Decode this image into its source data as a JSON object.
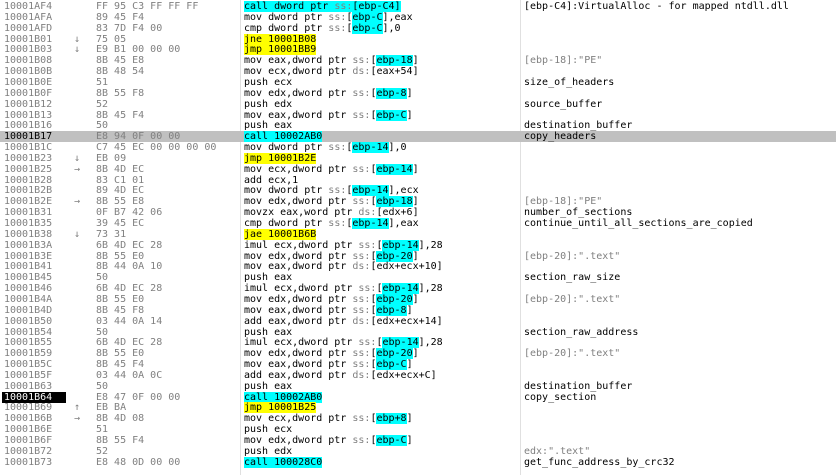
{
  "rows": [
    {
      "addr": "10001AF4",
      "arrow": "",
      "bytes": "FF 95 C3 FF FF FF",
      "mn": "call",
      "ops": "dword ptr ss:[ebp-C4]",
      "kind": "call",
      "comment": "[ebp-C4]:VirtualAlloc - for mapped ntdll.dll",
      "cgray": false
    },
    {
      "addr": "10001AFA",
      "arrow": "",
      "bytes": "89 45 F4",
      "mn": "mov",
      "ops": "dword ptr ss:[ebp-C],eax",
      "kind": "",
      "comment": "",
      "cgray": false
    },
    {
      "addr": "10001AFD",
      "arrow": "",
      "bytes": "83 7D F4 00",
      "mn": "cmp",
      "ops": "dword ptr ss:[ebp-C],0",
      "kind": "",
      "comment": "",
      "cgray": false
    },
    {
      "addr": "10001B01",
      "arrow": "v",
      "bytes": "75 05",
      "mn": "jne",
      "ops": "10001B08",
      "kind": "jcc",
      "comment": "",
      "cgray": false
    },
    {
      "addr": "10001B03",
      "arrow": "v",
      "bytes": "E9 B1 00 00 00",
      "mn": "jmp",
      "ops": "10001BB9",
      "kind": "jmp",
      "comment": "",
      "cgray": false
    },
    {
      "addr": "10001B08",
      "arrow": "",
      "bytes": "8B 45 E8",
      "mn": "mov",
      "ops": "eax,dword ptr ss:[ebp-18]",
      "kind": "",
      "comment": "[ebp-18]:\"PE\"",
      "cgray": true
    },
    {
      "addr": "10001B0B",
      "arrow": "",
      "bytes": "8B 48 54",
      "mn": "mov",
      "ops": "ecx,dword ptr ds:[eax+54]",
      "kind": "",
      "comment": "",
      "cgray": false
    },
    {
      "addr": "10001B0E",
      "arrow": "",
      "bytes": "51",
      "mn": "push",
      "ops": "ecx",
      "kind": "",
      "comment": "size_of_headers",
      "cgray": false
    },
    {
      "addr": "10001B0F",
      "arrow": "",
      "bytes": "8B 55 F8",
      "mn": "mov",
      "ops": "edx,dword ptr ss:[ebp-8]",
      "kind": "",
      "comment": "",
      "cgray": false
    },
    {
      "addr": "10001B12",
      "arrow": "",
      "bytes": "52",
      "mn": "push",
      "ops": "edx",
      "kind": "",
      "comment": "source_buffer",
      "cgray": false
    },
    {
      "addr": "10001B13",
      "arrow": "",
      "bytes": "8B 45 F4",
      "mn": "mov",
      "ops": "eax,dword ptr ss:[ebp-C]",
      "kind": "",
      "comment": "",
      "cgray": false
    },
    {
      "addr": "10001B16",
      "arrow": "",
      "bytes": "50",
      "mn": "push",
      "ops": "eax",
      "kind": "",
      "comment": "destination_buffer",
      "cgray": false
    },
    {
      "addr": "10001B17",
      "arrow": "",
      "bytes": "E8 94 0F 00 00",
      "mn": "call",
      "ops": "10002AB0",
      "kind": "call",
      "comment": "copy_headers",
      "cgray": false,
      "selected": true
    },
    {
      "addr": "10001B1C",
      "arrow": "",
      "bytes": "C7 45 EC 00 00 00 00",
      "mn": "mov",
      "ops": "dword ptr ss:[ebp-14],0",
      "kind": "",
      "comment": "",
      "cgray": false
    },
    {
      "addr": "10001B23",
      "arrow": "v",
      "bytes": "EB 09",
      "mn": "jmp",
      "ops": "10001B2E",
      "kind": "jmp",
      "comment": "",
      "cgray": false
    },
    {
      "addr": "10001B25",
      "arrow": ">",
      "bytes": "8B 4D EC",
      "mn": "mov",
      "ops": "ecx,dword ptr ss:[ebp-14]",
      "kind": "",
      "comment": "",
      "cgray": false
    },
    {
      "addr": "10001B28",
      "arrow": "",
      "bytes": "83 C1 01",
      "mn": "add",
      "ops": "ecx,1",
      "kind": "",
      "comment": "",
      "cgray": false
    },
    {
      "addr": "10001B2B",
      "arrow": "",
      "bytes": "89 4D EC",
      "mn": "mov",
      "ops": "dword ptr ss:[ebp-14],ecx",
      "kind": "",
      "comment": "",
      "cgray": false
    },
    {
      "addr": "10001B2E",
      "arrow": ">",
      "bytes": "8B 55 E8",
      "mn": "mov",
      "ops": "edx,dword ptr ss:[ebp-18]",
      "kind": "",
      "comment": "[ebp-18]:\"PE\"",
      "cgray": true
    },
    {
      "addr": "10001B31",
      "arrow": "",
      "bytes": "0F B7 42 06",
      "mn": "movzx",
      "ops": "eax,word ptr ds:[edx+6]",
      "kind": "",
      "comment": "number_of_sections",
      "cgray": false
    },
    {
      "addr": "10001B35",
      "arrow": "",
      "bytes": "39 45 EC",
      "mn": "cmp",
      "ops": "dword ptr ss:[ebp-14],eax",
      "kind": "",
      "comment": "continue_until_all_sections_are_copied",
      "cgray": false
    },
    {
      "addr": "10001B38",
      "arrow": "v",
      "bytes": "73 31",
      "mn": "jae",
      "ops": "10001B6B",
      "kind": "jcc",
      "comment": "",
      "cgray": false
    },
    {
      "addr": "10001B3A",
      "arrow": "",
      "bytes": "6B 4D EC 28",
      "mn": "imul",
      "ops": "ecx,dword ptr ss:[ebp-14],28",
      "kind": "",
      "comment": "",
      "cgray": false
    },
    {
      "addr": "10001B3E",
      "arrow": "",
      "bytes": "8B 55 E0",
      "mn": "mov",
      "ops": "edx,dword ptr ss:[ebp-20]",
      "kind": "",
      "comment": "[ebp-20]:\".text\"",
      "cgray": true
    },
    {
      "addr": "10001B41",
      "arrow": "",
      "bytes": "8B 44 0A 10",
      "mn": "mov",
      "ops": "eax,dword ptr ds:[edx+ecx+10]",
      "kind": "",
      "comment": "",
      "cgray": false
    },
    {
      "addr": "10001B45",
      "arrow": "",
      "bytes": "50",
      "mn": "push",
      "ops": "eax",
      "kind": "",
      "comment": "section_raw_size",
      "cgray": false
    },
    {
      "addr": "10001B46",
      "arrow": "",
      "bytes": "6B 4D EC 28",
      "mn": "imul",
      "ops": "ecx,dword ptr ss:[ebp-14],28",
      "kind": "",
      "comment": "",
      "cgray": false
    },
    {
      "addr": "10001B4A",
      "arrow": "",
      "bytes": "8B 55 E0",
      "mn": "mov",
      "ops": "edx,dword ptr ss:[ebp-20]",
      "kind": "",
      "comment": "[ebp-20]:\".text\"",
      "cgray": true
    },
    {
      "addr": "10001B4D",
      "arrow": "",
      "bytes": "8B 45 F8",
      "mn": "mov",
      "ops": "eax,dword ptr ss:[ebp-8]",
      "kind": "",
      "comment": "",
      "cgray": false
    },
    {
      "addr": "10001B50",
      "arrow": "",
      "bytes": "03 44 0A 14",
      "mn": "add",
      "ops": "eax,dword ptr ds:[edx+ecx+14]",
      "kind": "",
      "comment": "",
      "cgray": false
    },
    {
      "addr": "10001B54",
      "arrow": "",
      "bytes": "50",
      "mn": "push",
      "ops": "eax",
      "kind": "",
      "comment": "section_raw_address",
      "cgray": false
    },
    {
      "addr": "10001B55",
      "arrow": "",
      "bytes": "6B 4D EC 28",
      "mn": "imul",
      "ops": "ecx,dword ptr ss:[ebp-14],28",
      "kind": "",
      "comment": "",
      "cgray": false
    },
    {
      "addr": "10001B59",
      "arrow": "",
      "bytes": "8B 55 E0",
      "mn": "mov",
      "ops": "edx,dword ptr ss:[ebp-20]",
      "kind": "",
      "comment": "[ebp-20]:\".text\"",
      "cgray": true
    },
    {
      "addr": "10001B5C",
      "arrow": "",
      "bytes": "8B 45 F4",
      "mn": "mov",
      "ops": "eax,dword ptr ss:[ebp-C]",
      "kind": "",
      "comment": "",
      "cgray": false
    },
    {
      "addr": "10001B5F",
      "arrow": "",
      "bytes": "03 44 0A 0C",
      "mn": "add",
      "ops": "eax,dword ptr ds:[edx+ecx+C]",
      "kind": "",
      "comment": "",
      "cgray": false
    },
    {
      "addr": "10001B63",
      "arrow": "",
      "bytes": "50",
      "mn": "push",
      "ops": "eax",
      "kind": "",
      "comment": "destination_buffer",
      "cgray": false
    },
    {
      "addr": "10001B64",
      "arrow": "",
      "bytes": "E8 47 0F 00 00",
      "mn": "call",
      "ops": "10002AB0",
      "kind": "call",
      "comment": "copy_section",
      "cgray": false,
      "eip": true
    },
    {
      "addr": "10001B69",
      "arrow": "^",
      "bytes": "EB BA",
      "mn": "jmp",
      "ops": "10001B25",
      "kind": "jmp",
      "comment": "",
      "cgray": false
    },
    {
      "addr": "10001B6B",
      "arrow": ">",
      "bytes": "8B 4D 08",
      "mn": "mov",
      "ops": "ecx,dword ptr ss:[ebp+8]",
      "kind": "",
      "comment": "",
      "cgray": false
    },
    {
      "addr": "10001B6E",
      "arrow": "",
      "bytes": "51",
      "mn": "push",
      "ops": "ecx",
      "kind": "",
      "comment": "",
      "cgray": false
    },
    {
      "addr": "10001B6F",
      "arrow": "",
      "bytes": "8B 55 F4",
      "mn": "mov",
      "ops": "edx,dword ptr ss:[ebp-C]",
      "kind": "",
      "comment": "",
      "cgray": false
    },
    {
      "addr": "10001B72",
      "arrow": "",
      "bytes": "52",
      "mn": "push",
      "ops": "edx",
      "kind": "",
      "comment": "edx:\".text\"",
      "cgray": true
    },
    {
      "addr": "10001B73",
      "arrow": "",
      "bytes": "E8 48 0D 00 00",
      "mn": "call",
      "ops": "100028C0",
      "kind": "call",
      "comment": "get_func_address_by_crc32",
      "cgray": false
    }
  ]
}
